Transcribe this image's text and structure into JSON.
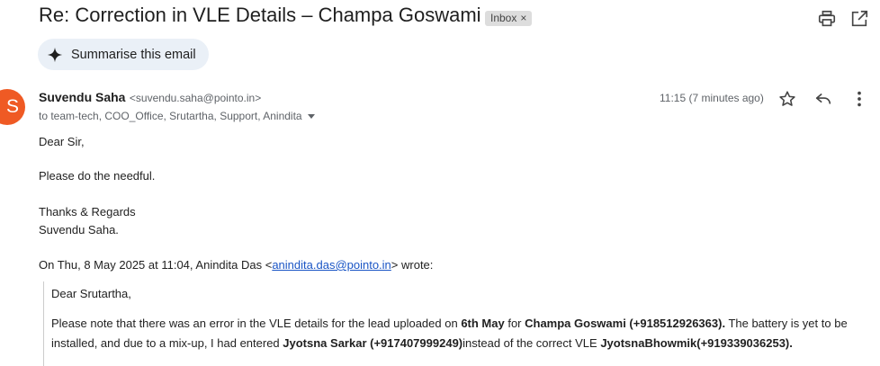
{
  "email": {
    "subject": "Re: Correction in VLE Details – Champa Goswami",
    "label": "Inbox",
    "label_close": "×"
  },
  "toolbar": {
    "summarise_label": "Summarise this email"
  },
  "sender": {
    "avatar_letter": "S",
    "name": "Suvendu Saha",
    "email": "<suvendu.saha@pointo.in>",
    "recipients": "to team-tech, COO_Office, Srutartha, Support, Anindita",
    "time": "11:15 (7 minutes ago)"
  },
  "body": {
    "greeting": "Dear Sir,",
    "line1": "Please do the needful.",
    "closing": "Thanks & Regards",
    "signature": "Suvendu Saha."
  },
  "quote": {
    "attrib_prefix": "On Thu, 8 May 2025 at 11:04, Anindita Das <",
    "attrib_email": "anindita.das@pointo.in",
    "attrib_suffix": "> wrote:",
    "greeting": "Dear Srutartha,",
    "p1_a": "Please note that there was an error in the VLE details for the lead uploaded on ",
    "p1_b": "6th May",
    "p1_c": " for ",
    "p1_d": "Champa Goswami (+918512926363).",
    "p1_e": " The battery is yet to be",
    "p2_a": "installed, and due to a mix-up, I had entered ",
    "p2_b": "Jyotsna Sarkar (+917407999249)",
    "p2_c": "instead of the correct VLE ",
    "p2_d": "JyotsnaBhowmik(+919339036253)."
  },
  "icons": {
    "print": "print-icon",
    "open_new_window": "open-in-new-window-icon",
    "sparkle": "sparkle-icon",
    "star": "star-icon",
    "reply": "reply-icon",
    "more": "more-vertical-icon"
  },
  "colors": {
    "avatar": "#ef5a24",
    "summarise_bg": "#eaf0f7",
    "link": "#1a55c5",
    "chip_bg": "#dddddd"
  }
}
